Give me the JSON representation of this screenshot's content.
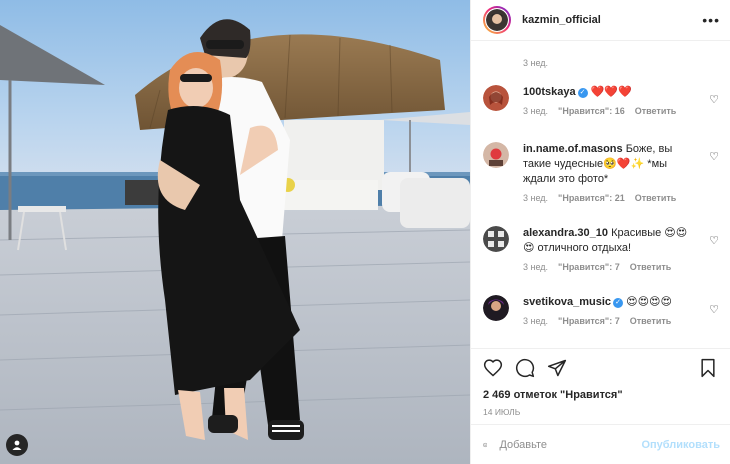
{
  "post": {
    "username": "kazmin_official",
    "more_icon": "more-horizontal-icon",
    "time_ago": "3 нед."
  },
  "comments": [
    {
      "username": "100tskaya",
      "verified": true,
      "text": "❤️❤️❤️",
      "time": "3 нед.",
      "likes": "\"Нравится\": 16",
      "reply": "Ответить"
    },
    {
      "username": "in.name.of.masons",
      "verified": false,
      "text": "Боже, вы такие чудесные🥺❤️✨ *мы ждали это фото*",
      "time": "3 нед.",
      "likes": "\"Нравится\": 21",
      "reply": "Ответить"
    },
    {
      "username": "alexandra.30_10",
      "verified": false,
      "text": "Красивые 😍😍😍 отличного отдыха!",
      "time": "3 нед.",
      "likes": "\"Нравится\": 7",
      "reply": "Ответить"
    },
    {
      "username": "svetikova_music",
      "verified": true,
      "text": "😍😍😍😍",
      "time": "3 нед.",
      "likes": "\"Нравится\": 7",
      "reply": "Ответить"
    }
  ],
  "actions": {
    "likes_count": "2 469 отметок \"Нравится\"",
    "date": "14 ИЮЛЬ"
  },
  "add_comment": {
    "placeholder": "Добавьте",
    "publish": "Опубликовать"
  },
  "colors": {
    "accent": "#0095f6",
    "publish_disabled": "#b2dffc",
    "muted": "#8e8e8e",
    "verified": "#3897f0"
  }
}
